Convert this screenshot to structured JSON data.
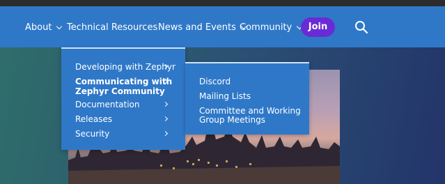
{
  "nav": {
    "about": "About",
    "technical_resources": "Technical Resources",
    "news_events": "News and Events",
    "community": "Community",
    "join": "Join",
    "search_icon": "search-icon"
  },
  "dropdown": {
    "items": [
      {
        "label": "Developing with Zephyr"
      },
      {
        "label": "Communicating with Zephyr Community"
      },
      {
        "label": "Documentation"
      },
      {
        "label": "Releases"
      },
      {
        "label": "Security"
      }
    ]
  },
  "submenu": {
    "items": [
      {
        "label": "Discord"
      },
      {
        "label": "Mailing Lists"
      },
      {
        "label": "Committee and Working Group Meetings"
      }
    ]
  },
  "colors": {
    "navbar": "#2f78c8",
    "join_button": "#6a2bd6",
    "topbar": "#2b2b2b"
  }
}
